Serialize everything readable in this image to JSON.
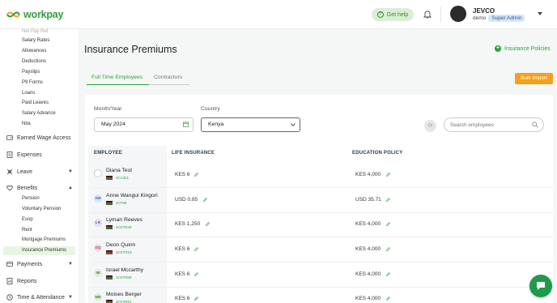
{
  "app": {
    "logo_text": "workpay",
    "brand_color": "#2f9e3d"
  },
  "header": {
    "help_label": "Get help",
    "user_name": "JEVCO",
    "user_sub": "demo",
    "role": "Super Admin"
  },
  "sidebar": {
    "sub_top": [
      "Salary Rates",
      "Allowances",
      "Deductions",
      "Payslips",
      "P9 Forms",
      "Loans",
      "Paid Leaves",
      "Salary Advance",
      "Nita"
    ],
    "main_ewa": "Earned Wage Access",
    "main_expenses": "Expenses",
    "main_leave": "Leave",
    "main_benefits": "Benefits",
    "benefits_items": [
      "Pension",
      "Voluntary Pension",
      "Esop",
      "Rent",
      "Mortgage Premiums",
      "Insurance Premiums"
    ],
    "main_payments": "Payments",
    "main_reports": "Reports",
    "main_time": "Time & Attendance"
  },
  "main": {
    "title": "Insurance Premiums",
    "insurance_policies": "Insurance Policies",
    "tabs": [
      "Full Time Employees",
      "Contractors"
    ],
    "bulk_import": "Bulk Import",
    "month_label": "Month/Year",
    "month_value": "May 2024",
    "country_label": "Country",
    "country_value": "Kenya",
    "search_placeholder": "Search employees",
    "columns": [
      "EMPLOYEE",
      "LIFE INSURANCE",
      "EDUCATION POLICY"
    ]
  },
  "employees": [
    {
      "initials": "",
      "name": "Diana Test",
      "code": "JCA321",
      "life": "KES 6",
      "edu": "KES 4,000",
      "av_bg": "#ffffff",
      "av_fg": "#333333"
    },
    {
      "initials": "AW",
      "name": "Anne Wangui Kingori",
      "code": "JCT99",
      "life": "USD 0.85",
      "edu": "USD 35.71",
      "av_bg": "#d6e4f5",
      "av_fg": "#4a6fa0"
    },
    {
      "initials": "LR",
      "name": "Lyman Reeves",
      "code": "JCKTR28",
      "life": "KES 1,250",
      "edu": "KES 4,000",
      "av_bg": "#e6dcf3",
      "av_fg": "#7a5aa5"
    },
    {
      "initials": "DQ",
      "name": "Deon Quinn",
      "code": "JCKTR19",
      "life": "KES 6",
      "edu": "KES 4,000",
      "av_bg": "#f5dbe4",
      "av_fg": "#a0506a"
    },
    {
      "initials": "IM",
      "name": "Israel Mccarthy",
      "code": "JCKTR09",
      "life": "KES 6",
      "edu": "KES 4,000",
      "av_bg": "#e0eedc",
      "av_fg": "#4f7f45"
    },
    {
      "initials": "MB",
      "name": "Moises Berger",
      "code": "JCKTR01",
      "life": "KES 6",
      "edu": "KES 4,000",
      "av_bg": "#e0eedc",
      "av_fg": "#4f7f45"
    }
  ]
}
